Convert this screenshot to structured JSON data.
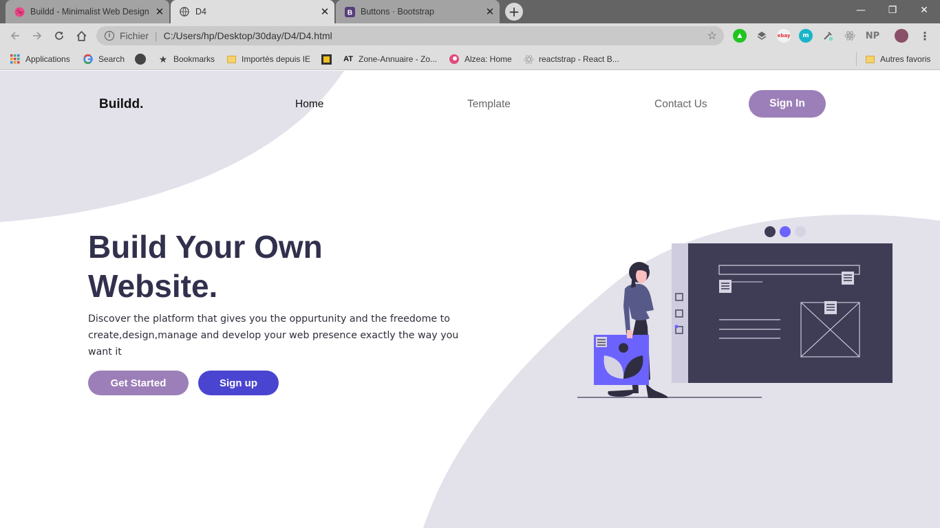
{
  "browser": {
    "tabs": [
      {
        "title": "Buildd - Minimalist Web Design b",
        "icon": "dribbble-icon",
        "active": false
      },
      {
        "title": "D4",
        "icon": "globe-icon",
        "active": true
      },
      {
        "title": "Buttons · Bootstrap",
        "icon": "bootstrap-icon",
        "active": false
      }
    ],
    "window_controls": {
      "minimize": "—",
      "restore": "❐",
      "close": "✕"
    },
    "omnibox": {
      "scheme_label": "Fichier",
      "url": "C:/Users/hp/Desktop/30day/D4/D4.html"
    },
    "extensions": {
      "np_label": "NP"
    },
    "bookmarks": [
      {
        "label": "Applications",
        "icon": "apps-grid-icon"
      },
      {
        "label": "Search",
        "icon": "google-icon"
      },
      {
        "label": "",
        "icon": "dark-circle-icon"
      },
      {
        "label": "Bookmarks",
        "icon": "star-icon"
      },
      {
        "label": "Importés depuis IE",
        "icon": "folder-icon"
      },
      {
        "label": "",
        "icon": "yellow-square-icon"
      },
      {
        "label": "Zone-Annuaire - Zo...",
        "icon": "zone-annuaire-icon"
      },
      {
        "label": "Alzea: Home",
        "icon": "alzea-icon"
      },
      {
        "label": "reactstrap - React B...",
        "icon": "react-icon"
      }
    ],
    "other_bookmarks": "Autres favoris"
  },
  "page": {
    "logo": "Buildd.",
    "nav": {
      "home": "Home",
      "template": "Template",
      "contact": "Contact Us",
      "signin": "Sign In"
    },
    "hero": {
      "title_line1": "Build Your Own",
      "title_line2": "Website.",
      "description": "Discover the platform that gives you the oppurtunity and the freedome to create,design,manage and develop your web presence exactly the way you want it",
      "btn_primary": "Get Started",
      "btn_secondary": "Sign up"
    }
  },
  "colors": {
    "accent_purple": "#9c7fb8",
    "accent_blue": "#4a45d0",
    "heading": "#31304d",
    "bg_blob": "#e3e1ea",
    "illustration_dark": "#3f3d56",
    "illustration_violet": "#6c63ff"
  }
}
